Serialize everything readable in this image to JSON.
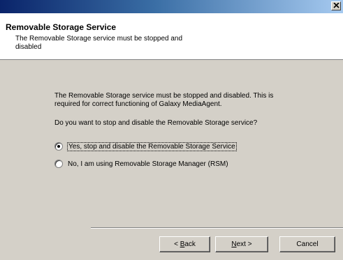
{
  "window": {
    "close_glyph": "×"
  },
  "header": {
    "title": "Removable Storage Service",
    "subtitle": "The Removable Storage service must be stopped and disabled"
  },
  "content": {
    "description": "The Removable Storage service must be stopped and disabled. This is required for correct functioning of Galaxy MediaAgent.",
    "question": "Do you want to stop and disable the Removable Storage service?",
    "options": [
      {
        "label": "Yes, stop and disable the Removable Storage Service",
        "selected": true
      },
      {
        "label": "No, I am using Removable Storage Manager (RSM)",
        "selected": false
      }
    ]
  },
  "buttons": {
    "back_prefix": "< ",
    "back_mnemonic": "B",
    "back_rest": "ack",
    "next_mnemonic": "N",
    "next_rest": "ext >",
    "cancel": "Cancel"
  },
  "colors": {
    "title_gradient_start": "#0a246a",
    "title_gradient_end": "#a6caf0",
    "dialog_face": "#d4d0c8",
    "header_bg": "#ffffff"
  }
}
